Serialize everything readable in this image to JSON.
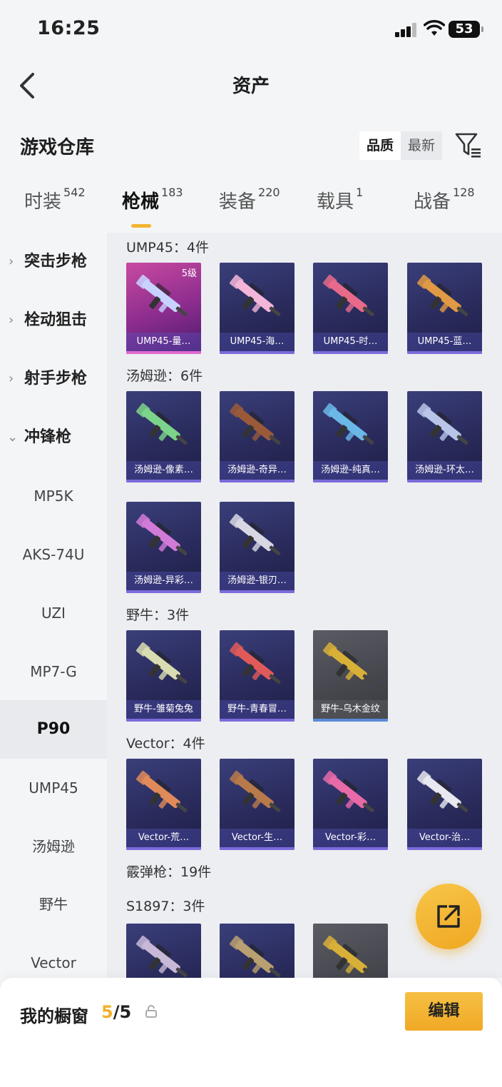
{
  "status_bar": {
    "time": "16:25",
    "battery": "53"
  },
  "nav": {
    "title": "资产"
  },
  "warehouse": {
    "title": "游戏仓库",
    "sort_options": [
      "品质",
      "最新"
    ]
  },
  "tabs": [
    {
      "label": "时装",
      "count": "542"
    },
    {
      "label": "枪械",
      "count": "183"
    },
    {
      "label": "装备",
      "count": "220"
    },
    {
      "label": "载具",
      "count": "1"
    },
    {
      "label": "战备",
      "count": "128"
    }
  ],
  "sidebar": {
    "groups": [
      "突击步枪",
      "栓动狙击",
      "射手步枪",
      "冲锋枪"
    ],
    "items": [
      "MP5K",
      "AKS-74U",
      "UZI",
      "MP7-G",
      "P90",
      "UMP45",
      "汤姆逊",
      "野牛",
      "Vector"
    ]
  },
  "content": {
    "groups": [
      {
        "title": "UMP45：4件",
        "cards": [
          {
            "label": "UMP45-量…",
            "level": "5级",
            "style": "gold",
            "color": "#c8d2ff"
          },
          {
            "label": "UMP45-海…",
            "style": "blue",
            "color": "#f3b6d8"
          },
          {
            "label": "UMP45-时…",
            "style": "blue",
            "color": "#e86a8a"
          },
          {
            "label": "UMP45-蓝…",
            "style": "blue",
            "color": "#e09a44"
          }
        ]
      },
      {
        "title": "汤姆逊：6件",
        "cards": [
          {
            "label": "汤姆逊-像素…",
            "style": "blue",
            "color": "#7bd48a"
          },
          {
            "label": "汤姆逊-奇异…",
            "style": "blue",
            "color": "#9a5a3a"
          },
          {
            "label": "汤姆逊-纯真…",
            "style": "blue",
            "color": "#6ab8e8"
          },
          {
            "label": "汤姆逊-环太…",
            "style": "blue",
            "color": "#b8c4e8"
          },
          {
            "label": "汤姆逊-异彩…",
            "style": "blue",
            "color": "#d27ad8"
          },
          {
            "label": "汤姆逊-银刃…",
            "style": "blue",
            "color": "#d8d8e4"
          }
        ]
      },
      {
        "title": "野牛：3件",
        "cards": [
          {
            "label": "野牛-雏菊兔兔",
            "style": "blue",
            "color": "#d8dcb0"
          },
          {
            "label": "野牛-青春冒…",
            "style": "blue",
            "color": "#e05a5a"
          },
          {
            "label": "野牛-乌木金纹",
            "style": "grey",
            "color": "#d8b038"
          }
        ]
      },
      {
        "title": "Vector：4件",
        "cards": [
          {
            "label": "Vector-荒…",
            "style": "blue",
            "color": "#e08a5a"
          },
          {
            "label": "Vector-生…",
            "style": "blue",
            "color": "#b87a4a"
          },
          {
            "label": "Vector-彩…",
            "style": "blue",
            "color": "#e86aa8"
          },
          {
            "label": "Vector-治…",
            "style": "blue",
            "color": "#e8e8f0"
          }
        ]
      },
      {
        "title": "霰弹枪：19件",
        "cards": []
      },
      {
        "title": "S1897：3件",
        "cards": [
          {
            "label": "",
            "style": "blue",
            "color": "#c8b8d8"
          },
          {
            "label": "",
            "style": "blue",
            "color": "#b8a070"
          },
          {
            "label": "",
            "style": "grey",
            "color": "#d8b038"
          }
        ]
      }
    ]
  },
  "showcase": {
    "title": "我的橱窗",
    "current": "5",
    "total": "/5",
    "edit_label": "编辑"
  },
  "colors": {
    "accent": "#f2b630",
    "card_blue": "#2a2b5c",
    "card_gold": "#8a2c8e"
  }
}
